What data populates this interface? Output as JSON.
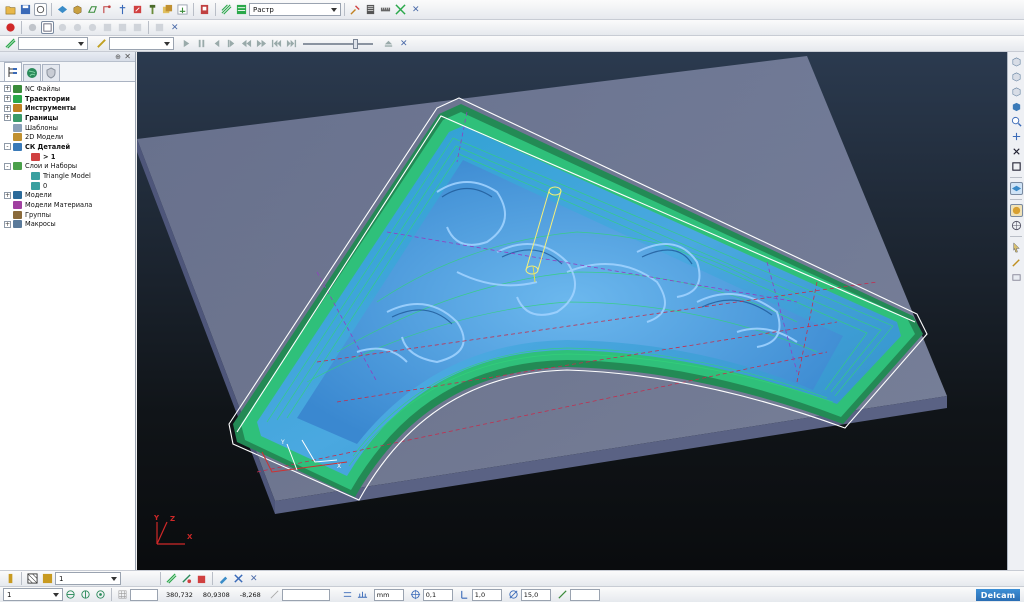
{
  "toolbar": {
    "strategy_dropdown": "Растр",
    "feedrate_dropdown": "",
    "speed_dropdown": ""
  },
  "explorer": {
    "tree": [
      {
        "label": "NC Файлы",
        "bold": false,
        "level": 0,
        "expander": "+",
        "icon": "nc-files-icon",
        "color": "#3a8c3a"
      },
      {
        "label": "Траектории",
        "bold": true,
        "level": 0,
        "expander": "+",
        "icon": "toolpaths-icon",
        "color": "#2aa84a"
      },
      {
        "label": "Инструменты",
        "bold": true,
        "level": 0,
        "expander": "+",
        "icon": "tools-icon",
        "color": "#c08020"
      },
      {
        "label": "Границы",
        "bold": true,
        "level": 0,
        "expander": "+",
        "icon": "boundaries-icon",
        "color": "#3a9a6a"
      },
      {
        "label": "Шаблоны",
        "bold": false,
        "level": 0,
        "expander": "",
        "icon": "patterns-icon",
        "color": "#8aa0b8"
      },
      {
        "label": "2D Модели",
        "bold": false,
        "level": 0,
        "expander": "",
        "icon": "2d-models-icon",
        "color": "#c09030"
      },
      {
        "label": "СК Деталей",
        "bold": true,
        "level": 0,
        "expander": "-",
        "icon": "workplanes-icon",
        "color": "#3a7ab8"
      },
      {
        "label": "> 1",
        "bold": true,
        "level": 1,
        "expander": "",
        "icon": "workplane-icon",
        "color": "#d04040"
      },
      {
        "label": "Слои и Наборы",
        "bold": false,
        "level": 0,
        "expander": "-",
        "icon": "levels-icon",
        "color": "#4aa04a"
      },
      {
        "label": "Triangle Model",
        "bold": false,
        "level": 1,
        "expander": "",
        "icon": "level-icon",
        "color": "#3aa0a0"
      },
      {
        "label": "0",
        "bold": false,
        "level": 1,
        "expander": "",
        "icon": "level-icon",
        "color": "#3aa0a0"
      },
      {
        "label": "Модели",
        "bold": false,
        "level": 0,
        "expander": "+",
        "icon": "models-icon",
        "color": "#2a6a9a"
      },
      {
        "label": "Модели Материала",
        "bold": false,
        "level": 0,
        "expander": "",
        "icon": "stock-models-icon",
        "color": "#a040a0"
      },
      {
        "label": "Группы",
        "bold": false,
        "level": 0,
        "expander": "",
        "icon": "groups-icon",
        "color": "#8a6a3a"
      },
      {
        "label": "Макросы",
        "bold": false,
        "level": 0,
        "expander": "+",
        "icon": "macros-icon",
        "color": "#5a7a9a"
      }
    ]
  },
  "viewport": {
    "axis_labels": {
      "x": "X",
      "y": "Y",
      "z": "Z"
    }
  },
  "bottom1": {
    "layer_value": "1"
  },
  "bottom2": {
    "value_dropdown": "1",
    "coord_x": "380,732",
    "coord_y": "80,9308",
    "coord_z": "-8,268",
    "units": "mm",
    "tolerance": "0,1",
    "stepover": "1,0",
    "angle": "15,0",
    "brand": "Delcam"
  },
  "colors": {
    "stock": "#8c96b4",
    "surface": "#3ea3d6",
    "toolpath": "#33d27a",
    "boundary": "#ffffff",
    "brand": "#2a6db3"
  }
}
